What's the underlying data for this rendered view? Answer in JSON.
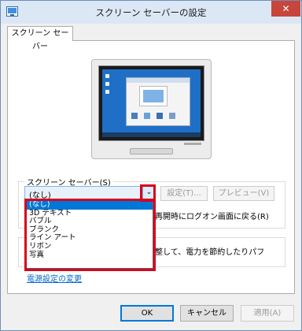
{
  "window": {
    "title": "スクリーン セーバーの設定",
    "close_glyph": "✕"
  },
  "tabs": [
    {
      "label": "スクリーン セーバー"
    }
  ],
  "screensaver": {
    "group_label": "スクリーン セーバー(S)",
    "selected": "(なし)",
    "settings_button": "設定(T)...",
    "preview_button": "プレビュー(V)",
    "resume_text": "再開時にログオン画面に戻る(R)",
    "options": [
      "(なし)",
      "3D テキスト",
      "バブル",
      "ブランク",
      "ライン アート",
      "リボン",
      "写真"
    ],
    "selected_index": 0
  },
  "power": {
    "text": "整して、電力を節約したりパフ",
    "link": "電源設定の変更"
  },
  "footer": {
    "ok": "OK",
    "cancel": "キャンセル",
    "apply": "適用(A)"
  },
  "colors": {
    "highlight_box": "#d9001b",
    "selection": "#0078d7",
    "link": "#0066cc"
  },
  "icons": {
    "dropdown_arrow": "chevron-down-icon",
    "app": "monitor-icon"
  }
}
